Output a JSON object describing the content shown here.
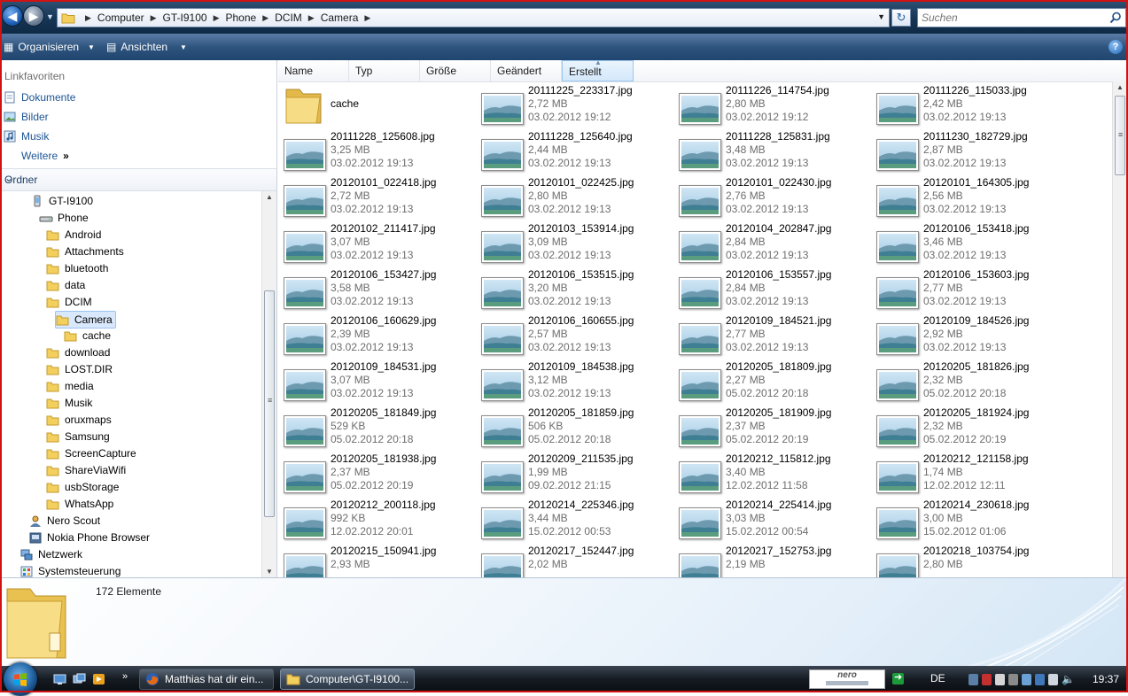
{
  "address": {
    "crumbs": [
      "Computer",
      "GT-I9100",
      "Phone",
      "DCIM",
      "Camera"
    ],
    "search_placeholder": "Suchen"
  },
  "toolbar": {
    "organize_label": "Organisieren",
    "views_label": "Ansichten"
  },
  "nav": {
    "favorites_heading": "Linkfavoriten",
    "favorites": [
      "Dokumente",
      "Bilder",
      "Musik",
      "Weitere"
    ],
    "more_glyph": "»",
    "folders_heading": "Ordner",
    "tree": [
      {
        "label": "GT-I9100",
        "level": 0,
        "icon": "phone-icon"
      },
      {
        "label": "Phone",
        "level": 1,
        "icon": "drive-icon"
      },
      {
        "label": "Android",
        "level": 2,
        "icon": "folder-icon"
      },
      {
        "label": "Attachments",
        "level": 2,
        "icon": "folder-icon"
      },
      {
        "label": "bluetooth",
        "level": 2,
        "icon": "folder-icon"
      },
      {
        "label": "data",
        "level": 2,
        "icon": "folder-icon"
      },
      {
        "label": "DCIM",
        "level": 2,
        "icon": "folder-icon"
      },
      {
        "label": "Camera",
        "level": 3,
        "icon": "folder-icon",
        "selected": true
      },
      {
        "label": "cache",
        "level": 4,
        "icon": "folder-icon"
      },
      {
        "label": "download",
        "level": 2,
        "icon": "folder-icon"
      },
      {
        "label": "LOST.DIR",
        "level": 2,
        "icon": "folder-icon"
      },
      {
        "label": "media",
        "level": 2,
        "icon": "folder-icon"
      },
      {
        "label": "Musik",
        "level": 2,
        "icon": "folder-icon"
      },
      {
        "label": "oruxmaps",
        "level": 2,
        "icon": "folder-icon"
      },
      {
        "label": "Samsung",
        "level": 2,
        "icon": "folder-icon"
      },
      {
        "label": "ScreenCapture",
        "level": 2,
        "icon": "folder-icon"
      },
      {
        "label": "ShareViaWifi",
        "level": 2,
        "icon": "folder-icon"
      },
      {
        "label": "usbStorage",
        "level": 2,
        "icon": "folder-icon"
      },
      {
        "label": "WhatsApp",
        "level": 2,
        "icon": "folder-icon"
      },
      {
        "label": "Nero Scout",
        "level": -1,
        "icon": "nero-scout-icon"
      },
      {
        "label": "Nokia Phone Browser",
        "level": -1,
        "icon": "nokia-icon"
      },
      {
        "label": "Netzwerk",
        "level": -2,
        "icon": "network-icon"
      },
      {
        "label": "Systemsteuerung",
        "level": -2,
        "icon": "control-panel-icon"
      }
    ]
  },
  "columns": [
    "Name",
    "Typ",
    "Größe",
    "Geändert",
    "Erstellt"
  ],
  "sorted_column": "Erstellt",
  "files": [
    {
      "name": "cache",
      "folder": true
    },
    {
      "name": "20111225_223317.jpg",
      "size": "2,72 MB",
      "date": "03.02.2012 19:12"
    },
    {
      "name": "20111226_114754.jpg",
      "size": "2,80 MB",
      "date": "03.02.2012 19:12"
    },
    {
      "name": "20111226_115033.jpg",
      "size": "2,42 MB",
      "date": "03.02.2012 19:13"
    },
    {
      "name": "20111228_125608.jpg",
      "size": "3,25 MB",
      "date": "03.02.2012 19:13"
    },
    {
      "name": "20111228_125640.jpg",
      "size": "2,44 MB",
      "date": "03.02.2012 19:13"
    },
    {
      "name": "20111228_125831.jpg",
      "size": "3,48 MB",
      "date": "03.02.2012 19:13"
    },
    {
      "name": "20111230_182729.jpg",
      "size": "2,87 MB",
      "date": "03.02.2012 19:13"
    },
    {
      "name": "20120101_022418.jpg",
      "size": "2,72 MB",
      "date": "03.02.2012 19:13"
    },
    {
      "name": "20120101_022425.jpg",
      "size": "2,80 MB",
      "date": "03.02.2012 19:13"
    },
    {
      "name": "20120101_022430.jpg",
      "size": "2,76 MB",
      "date": "03.02.2012 19:13"
    },
    {
      "name": "20120101_164305.jpg",
      "size": "2,56 MB",
      "date": "03.02.2012 19:13"
    },
    {
      "name": "20120102_211417.jpg",
      "size": "3,07 MB",
      "date": "03.02.2012 19:13"
    },
    {
      "name": "20120103_153914.jpg",
      "size": "3,09 MB",
      "date": "03.02.2012 19:13"
    },
    {
      "name": "20120104_202847.jpg",
      "size": "2,84 MB",
      "date": "03.02.2012 19:13"
    },
    {
      "name": "20120106_153418.jpg",
      "size": "3,46 MB",
      "date": "03.02.2012 19:13"
    },
    {
      "name": "20120106_153427.jpg",
      "size": "3,58 MB",
      "date": "03.02.2012 19:13"
    },
    {
      "name": "20120106_153515.jpg",
      "size": "3,20 MB",
      "date": "03.02.2012 19:13"
    },
    {
      "name": "20120106_153557.jpg",
      "size": "2,84 MB",
      "date": "03.02.2012 19:13"
    },
    {
      "name": "20120106_153603.jpg",
      "size": "2,77 MB",
      "date": "03.02.2012 19:13"
    },
    {
      "name": "20120106_160629.jpg",
      "size": "2,39 MB",
      "date": "03.02.2012 19:13"
    },
    {
      "name": "20120106_160655.jpg",
      "size": "2,57 MB",
      "date": "03.02.2012 19:13"
    },
    {
      "name": "20120109_184521.jpg",
      "size": "2,77 MB",
      "date": "03.02.2012 19:13"
    },
    {
      "name": "20120109_184526.jpg",
      "size": "2,92 MB",
      "date": "03.02.2012 19:13"
    },
    {
      "name": "20120109_184531.jpg",
      "size": "3,07 MB",
      "date": "03.02.2012 19:13"
    },
    {
      "name": "20120109_184538.jpg",
      "size": "3,12 MB",
      "date": "03.02.2012 19:13"
    },
    {
      "name": "20120205_181809.jpg",
      "size": "2,27 MB",
      "date": "05.02.2012 20:18"
    },
    {
      "name": "20120205_181826.jpg",
      "size": "2,32 MB",
      "date": "05.02.2012 20:18"
    },
    {
      "name": "20120205_181849.jpg",
      "size": "529 KB",
      "date": "05.02.2012 20:18"
    },
    {
      "name": "20120205_181859.jpg",
      "size": "506 KB",
      "date": "05.02.2012 20:18"
    },
    {
      "name": "20120205_181909.jpg",
      "size": "2,37 MB",
      "date": "05.02.2012 20:19"
    },
    {
      "name": "20120205_181924.jpg",
      "size": "2,32 MB",
      "date": "05.02.2012 20:19"
    },
    {
      "name": "20120205_181938.jpg",
      "size": "2,37 MB",
      "date": "05.02.2012 20:19"
    },
    {
      "name": "20120209_211535.jpg",
      "size": "1,99 MB",
      "date": "09.02.2012 21:15"
    },
    {
      "name": "20120212_115812.jpg",
      "size": "3,40 MB",
      "date": "12.02.2012 11:58"
    },
    {
      "name": "20120212_121158.jpg",
      "size": "1,74 MB",
      "date": "12.02.2012 12:11"
    },
    {
      "name": "20120212_200118.jpg",
      "size": "992 KB",
      "date": "12.02.2012 20:01"
    },
    {
      "name": "20120214_225346.jpg",
      "size": "3,44 MB",
      "date": "15.02.2012 00:53"
    },
    {
      "name": "20120214_225414.jpg",
      "size": "3,03 MB",
      "date": "15.02.2012 00:54"
    },
    {
      "name": "20120214_230618.jpg",
      "size": "3,00 MB",
      "date": "15.02.2012 01:06"
    },
    {
      "name": "20120215_150941.jpg",
      "size": "2,93 MB",
      "date": ""
    },
    {
      "name": "20120217_152447.jpg",
      "size": "2,02 MB",
      "date": ""
    },
    {
      "name": "20120217_152753.jpg",
      "size": "2,19 MB",
      "date": ""
    },
    {
      "name": "20120218_103754.jpg",
      "size": "2,80 MB",
      "date": ""
    }
  ],
  "details": {
    "count": "172 Elemente"
  },
  "taskbar": {
    "tasks": [
      "Matthias hat dir ein...",
      "Computer\\GT-I9100..."
    ],
    "nero": "nero",
    "language": "DE",
    "clock": "19:37"
  },
  "colors": {
    "accent": "#1c5494",
    "selection": "#d9e8fb",
    "frame": "#d11212"
  }
}
